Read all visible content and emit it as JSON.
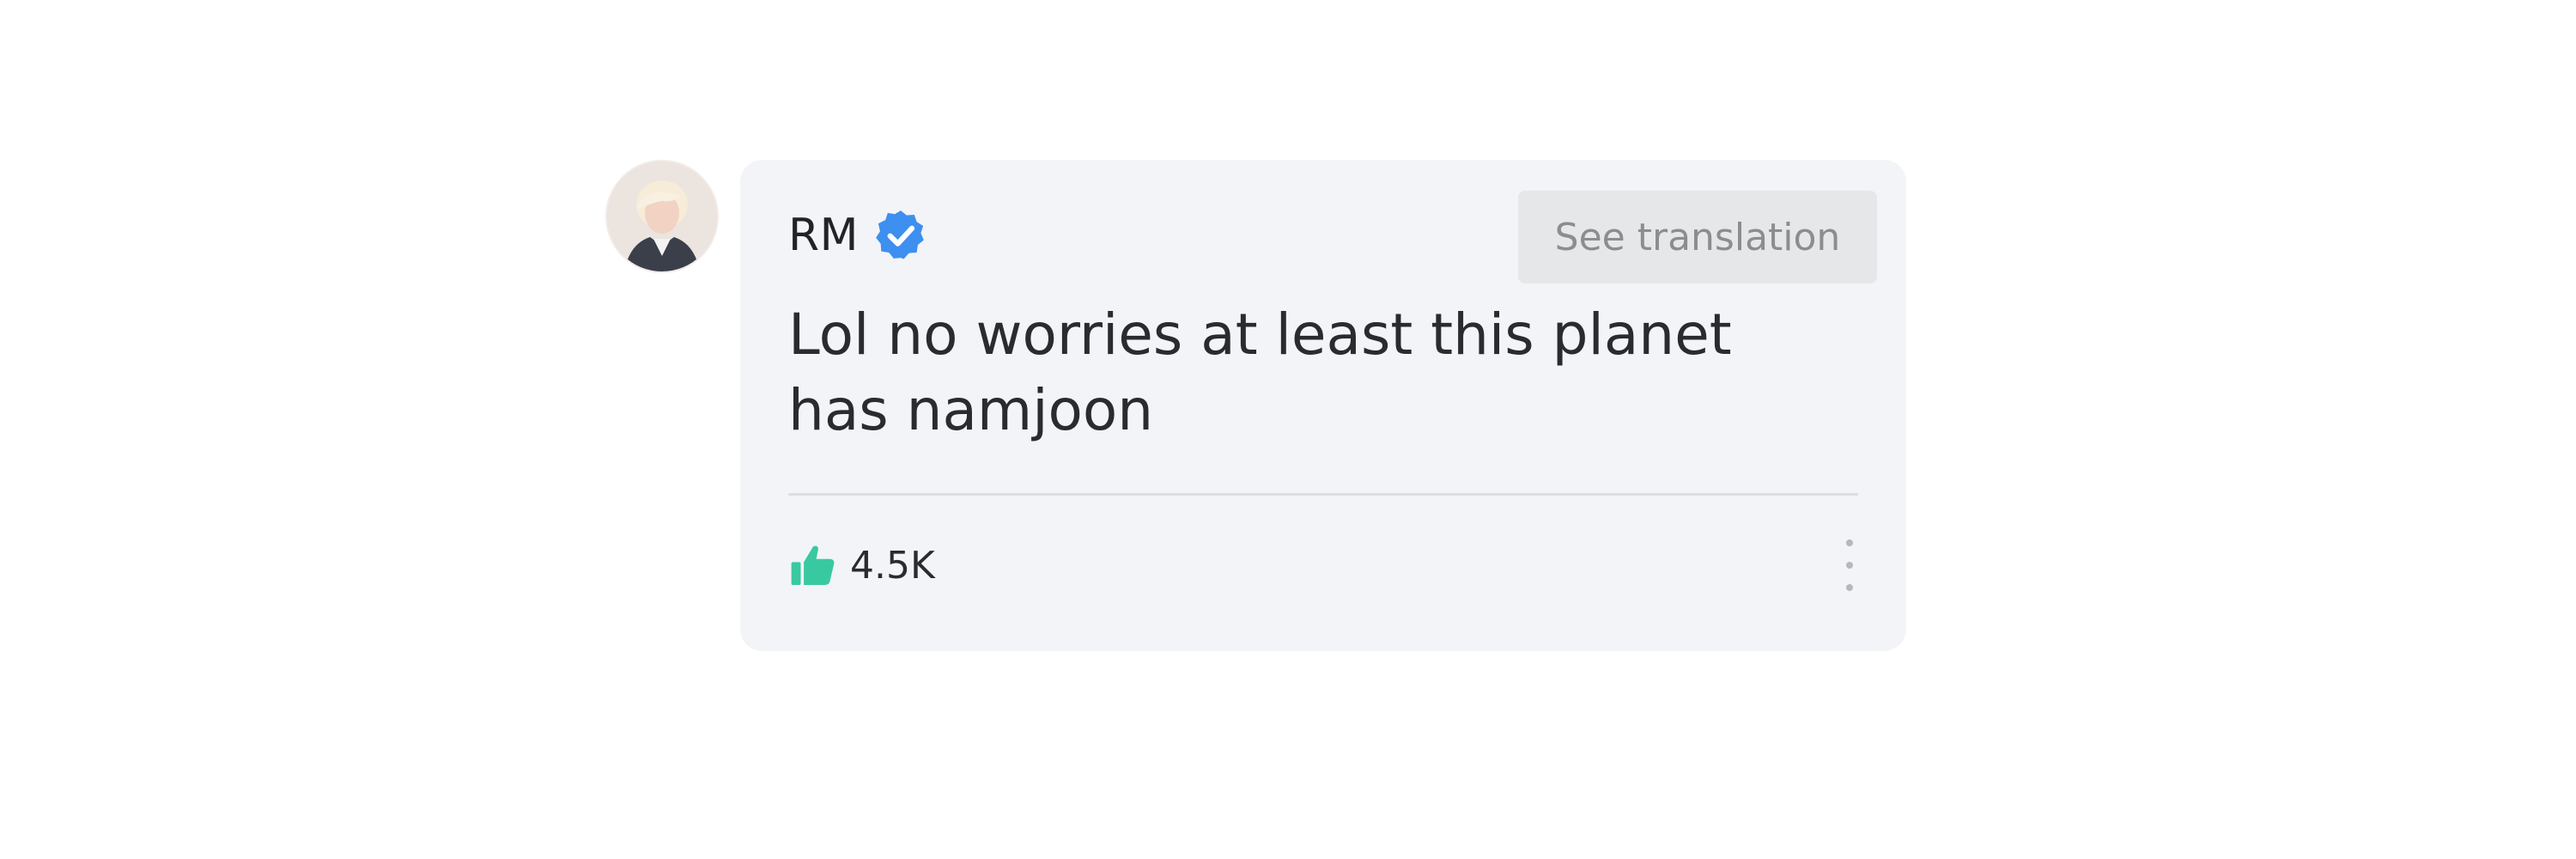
{
  "comment": {
    "author": "RM",
    "verified": true,
    "translate_label": "See translation",
    "text_line1": "Lol no worries at least this planet",
    "text_line2": "has namjoon",
    "likes": "4.5K"
  },
  "icons": {
    "avatar": "profile-photo",
    "verified": "verified-badge-icon",
    "like": "thumbs-up-icon",
    "more": "more-options-icon"
  },
  "colors": {
    "card_background": "#f3f4f7",
    "verified_badge": "#3d8ff0",
    "like_icon": "#39c9a0",
    "translate_button_bg": "#e6e7e9",
    "translate_button_text": "#8b8d90"
  }
}
